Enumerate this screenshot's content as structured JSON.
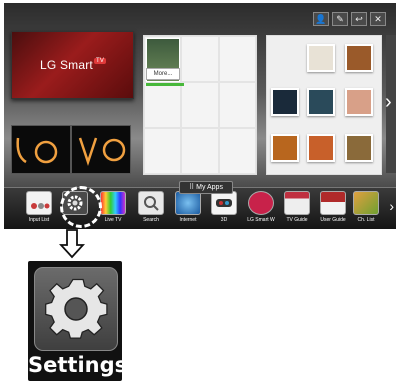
{
  "top_buttons": [
    {
      "icon": "person-icon",
      "glyph": "👤"
    },
    {
      "icon": "edit-icon",
      "glyph": "✎"
    },
    {
      "icon": "back-icon",
      "glyph": "↩"
    },
    {
      "icon": "close-icon",
      "glyph": "✕"
    }
  ],
  "lg_card": {
    "logo_text": "LG Smart",
    "tv_badge": "TV"
  },
  "premium_panel": {
    "more_label": "More..."
  },
  "dock": {
    "title": "My Apps",
    "apps": [
      {
        "label": "Input List",
        "icon": "input-list-icon",
        "color": "#c83a3a"
      },
      {
        "label": "",
        "icon": "settings-icon",
        "color": "#555555"
      },
      {
        "label": "Live TV",
        "icon": "live-tv-icon",
        "color": "#3aa0e0"
      },
      {
        "label": "Search",
        "icon": "search-icon",
        "color": "#dddddd"
      },
      {
        "label": "Internet",
        "icon": "internet-icon",
        "color": "#3a7ad0"
      },
      {
        "label": "3D",
        "icon": "3d-icon",
        "color": "#cc4444"
      },
      {
        "label": "LG Smart W",
        "icon": "lg-smart-world-icon",
        "color": "#cc2244"
      },
      {
        "label": "TV Guide",
        "icon": "tv-guide-icon",
        "color": "#c03040"
      },
      {
        "label": "User Guide",
        "icon": "user-guide-icon",
        "color": "#b02a2a"
      },
      {
        "label": "Ch. List",
        "icon": "ch-list-icon",
        "color": "#e0a040"
      }
    ]
  },
  "settings_tile": {
    "label": "Settings"
  }
}
